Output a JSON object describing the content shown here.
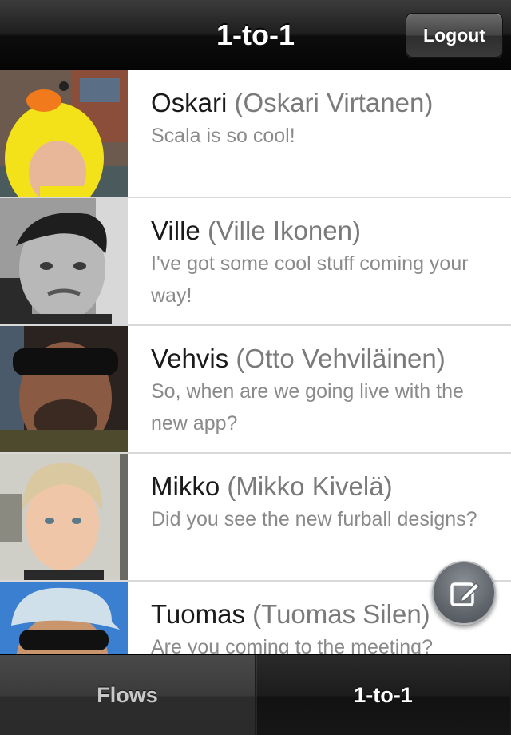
{
  "navbar": {
    "title": "1-to-1",
    "logout_label": "Logout"
  },
  "contacts": [
    {
      "nick": "Oskari",
      "fullname": "(Oskari Virtanen)",
      "message": "Scala is so cool!"
    },
    {
      "nick": "Ville",
      "fullname": "(Ville Ikonen)",
      "message": "I've got some cool stuff coming your way!"
    },
    {
      "nick": "Vehvis",
      "fullname": "(Otto Vehviläinen)",
      "message": "So, when are we going live with the new app?"
    },
    {
      "nick": "Mikko",
      "fullname": "(Mikko Kivelä)",
      "message": "Did you see the new furball designs?"
    },
    {
      "nick": "Tuomas",
      "fullname": "(Tuomas Silen)",
      "message": "Are you coming to the meeting?"
    }
  ],
  "compose": {
    "icon": "compose-icon"
  },
  "tabs": [
    {
      "label": "Flows",
      "selected": false
    },
    {
      "label": "1-to-1",
      "selected": true
    }
  ]
}
